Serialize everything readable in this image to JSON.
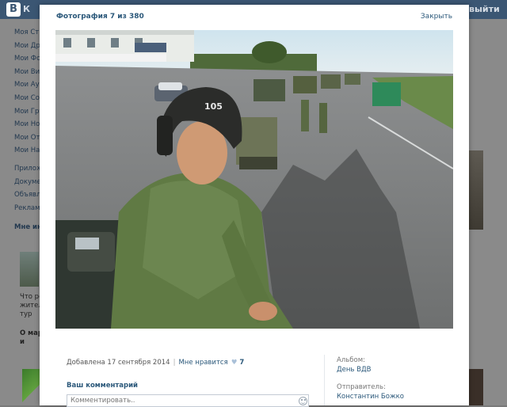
{
  "header": {
    "logo_letter": "В",
    "logo_text": "К",
    "right_text": "выйти"
  },
  "left_menu": {
    "items": [
      "Моя Страница",
      "Мои Друзья",
      "Мои Фотографии",
      "Мои Видеозаписи",
      "Мои Аудиозаписи",
      "Мои Сообщения",
      "Мои Группы",
      "Мои Новости",
      "Мои Ответы",
      "Мои Настройки"
    ],
    "extra": [
      "Приложения",
      "Документы",
      "Объявления",
      "Реклама"
    ],
    "block_title": "Мне интересно",
    "news_lines": [
      "Что ре",
      "жител",
      "тур"
    ],
    "block2_lines": [
      "О мар",
      "и"
    ]
  },
  "modal": {
    "title": "Фотография 7 из 380",
    "close_label": "Закрыть",
    "photo_sign": "105",
    "added": "Добавлена 17 сентября 2014",
    "like_label": "Мне нравится",
    "like_count": "7",
    "comment_title": "Ваш комментарий",
    "comment_placeholder": "Комментировать..",
    "album_label": "Альбом:",
    "album_value": "День ВДВ",
    "sender_label": "Отправитель:",
    "sender_value": "Константин Божко"
  },
  "colors": {
    "vk_header": "#3b5673",
    "link": "#2b587a"
  },
  "icons": [
    "heart-icon",
    "smile-icon"
  ]
}
